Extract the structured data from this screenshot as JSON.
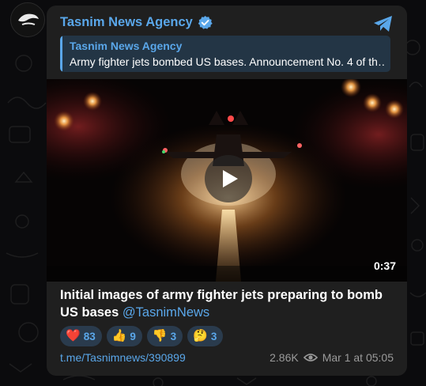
{
  "channel": {
    "name": "Tasnim News Agency",
    "accent_color": "#5aa7ea"
  },
  "reply": {
    "title": "Tasnim News Agency",
    "text": "Army fighter jets bombed US bases. Announcement No. 4 of th…"
  },
  "video": {
    "duration": "0:37"
  },
  "post": {
    "caption": "Initial images of army fighter jets preparing to bomb US bases",
    "mention": "@TasnimNews",
    "link": "t.me/Tasnimnews/390899",
    "views": "2.86K",
    "date": "Mar 1 at 05:05"
  },
  "reactions": [
    {
      "emoji": "❤️",
      "count": "83"
    },
    {
      "emoji": "👍",
      "count": "9"
    },
    {
      "emoji": "👎",
      "count": "3"
    },
    {
      "emoji": "🤔",
      "count": "3"
    }
  ],
  "icons": {
    "verified": "verified-badge-icon",
    "share": "telegram-share-icon",
    "play": "play-icon",
    "views": "eye-icon"
  }
}
